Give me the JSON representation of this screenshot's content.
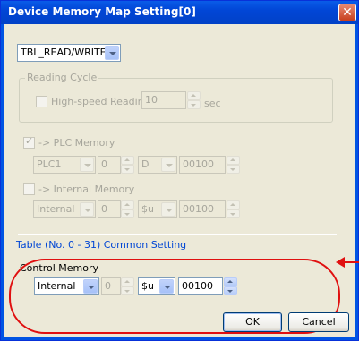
{
  "window": {
    "title": "Device Memory Map Setting[0]",
    "close_glyph": "✕"
  },
  "mode_select": {
    "value": "TBL_READ/WRITE"
  },
  "reading_cycle": {
    "group_label": "Reading Cycle",
    "high_speed_label": "High-speed Reading",
    "interval_value": "10",
    "unit": "sec"
  },
  "plc_memory": {
    "label": "-> PLC Memory",
    "checked": true,
    "check_glyph": "✓",
    "station": "PLC1",
    "station_no": "0",
    "device": "D",
    "address": "00100"
  },
  "internal_memory": {
    "label": "-> Internal Memory",
    "checked": false,
    "station": "Internal",
    "station_no": "0",
    "device": "$u",
    "address": "00100"
  },
  "common_setting": {
    "group_label": "Table (No. 0 - 31) Common Setting",
    "control_memory_label": "Control Memory",
    "station": "Internal",
    "station_no": "0",
    "device": "$u",
    "address": "00100"
  },
  "buttons": {
    "ok": "OK",
    "cancel": "Cancel"
  },
  "colors": {
    "highlight": "#e01010",
    "title_bar": "#0054e3",
    "group_label": "#0046d5"
  }
}
